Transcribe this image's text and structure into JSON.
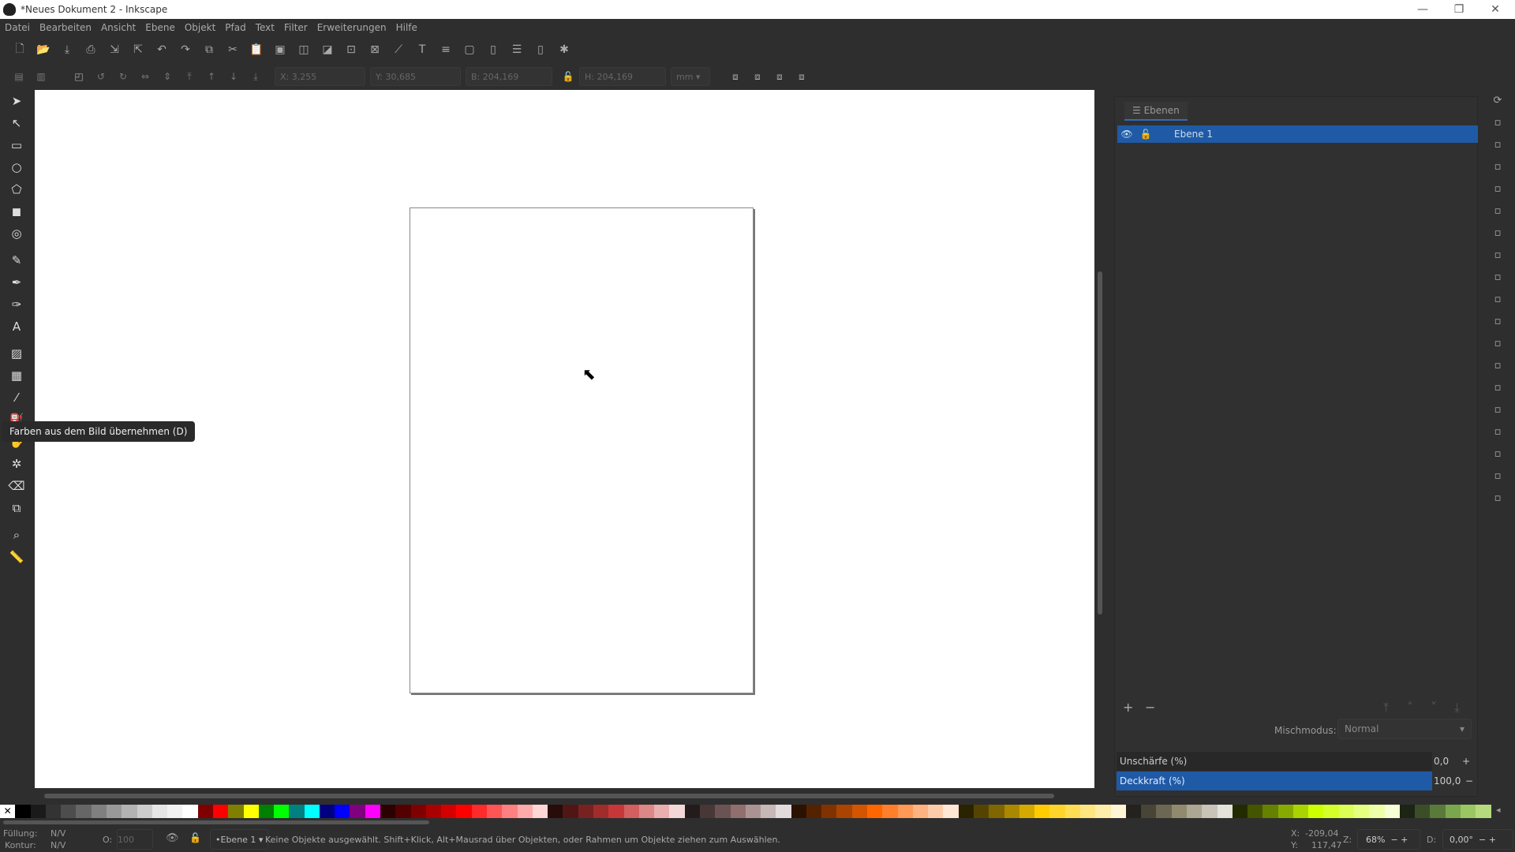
{
  "window": {
    "title": "*Neues Dokument 2 - Inkscape",
    "minimize": "—",
    "maximize": "❐",
    "close": "✕"
  },
  "menu": [
    "Datei",
    "Bearbeiten",
    "Ansicht",
    "Ebene",
    "Objekt",
    "Pfad",
    "Text",
    "Filter",
    "Erweiterungen",
    "Hilfe"
  ],
  "toolbar1_icons": [
    "new-icon",
    "open-icon",
    "save-icon",
    "print-icon",
    "import-icon",
    "export-icon",
    "undo-icon",
    "redo-icon",
    "duplicate-icon",
    "cut-icon",
    "paste-icon",
    "group-icon",
    "raise-icon",
    "lower-icon",
    "zoom-selection-icon",
    "zoom-drawing-icon",
    "xml-editor-icon",
    "text-font-icon",
    "align-icon",
    "fill-stroke-icon",
    "layers-icon",
    "object-properties-icon",
    "document-properties-icon",
    "preferences-icon"
  ],
  "toolbar2": {
    "x_label": "X:",
    "x": "3,255",
    "y_label": "Y:",
    "y": "30,685",
    "w_label": "B:",
    "w": "204,169",
    "h_label": "H:",
    "h": "204,169",
    "unit": "mm"
  },
  "tools": [
    {
      "name": "selector",
      "g": "➤"
    },
    {
      "name": "node",
      "g": "↖"
    },
    {
      "name": "rectangle",
      "g": "▭"
    },
    {
      "name": "ellipse",
      "g": "○"
    },
    {
      "name": "star",
      "g": "⬠"
    },
    {
      "name": "3d-box",
      "g": "◼"
    },
    {
      "name": "spiral",
      "g": "◎"
    },
    {
      "name": "pencil",
      "g": "✎"
    },
    {
      "name": "pen",
      "g": "✒"
    },
    {
      "name": "calligraphy",
      "g": "✑"
    },
    {
      "name": "text",
      "g": "A"
    },
    {
      "name": "gradient",
      "g": "▨"
    },
    {
      "name": "mesh",
      "g": "▦"
    },
    {
      "name": "dropper",
      "g": "⁄"
    },
    {
      "name": "paint-bucket",
      "g": "⛽"
    },
    {
      "name": "tweak",
      "g": "✋"
    },
    {
      "name": "spray",
      "g": "✲"
    },
    {
      "name": "eraser",
      "g": "⌫"
    },
    {
      "name": "connector",
      "g": "⧉"
    },
    {
      "name": "zoom",
      "g": "⌕"
    },
    {
      "name": "measure",
      "g": "📏"
    }
  ],
  "tooltip": "Farben aus dem Bild übernehmen (D)",
  "panel": {
    "tab": "Ebenen",
    "tab_close": "×",
    "layer": "Ebene 1",
    "add": "+",
    "remove": "−",
    "blend_label": "Mischmodus:",
    "blend_value": "Normal",
    "blur_label": "Unschärfe (%)",
    "blur_value": "0,0",
    "opacity_label": "Deckkraft (%)",
    "opacity_value": "100,0"
  },
  "palette": [
    "#000000",
    "#1a1a1a",
    "#333333",
    "#4d4d4d",
    "#666666",
    "#808080",
    "#999999",
    "#b3b3b3",
    "#cccccc",
    "#e6e6e6",
    "#f2f2f2",
    "#ffffff",
    "#800000",
    "#ff0000",
    "#808000",
    "#ffff00",
    "#008000",
    "#00ff00",
    "#008080",
    "#00ffff",
    "#000080",
    "#0000ff",
    "#800080",
    "#ff00ff",
    "#2b0000",
    "#550000",
    "#800000",
    "#aa0000",
    "#d40000",
    "#ff0000",
    "#ff2a2a",
    "#ff5555",
    "#ff8080",
    "#ffaaaa",
    "#ffd5d5",
    "#280b0b",
    "#501616",
    "#782121",
    "#a02c2c",
    "#c83737",
    "#d35f5f",
    "#de8787",
    "#e9afaf",
    "#f4d7d7",
    "#241c1c",
    "#483737",
    "#6c5353",
    "#916f6f",
    "#ac9393",
    "#c8b7b7",
    "#e3dbdb",
    "#2b1100",
    "#552200",
    "#803300",
    "#aa4400",
    "#d45500",
    "#ff6600",
    "#ff7f2a",
    "#ff9955",
    "#ffb380",
    "#ffccaa",
    "#ffe6d5",
    "#2b2200",
    "#554400",
    "#806600",
    "#aa8800",
    "#d4aa00",
    "#ffcc00",
    "#ffd42a",
    "#ffdd55",
    "#ffe680",
    "#ffeeaa",
    "#fff6d5",
    "#24221c",
    "#484537",
    "#6c6753",
    "#918a6f",
    "#aca793",
    "#c8c4b7",
    "#e3e2db",
    "#222b00",
    "#445500",
    "#668000",
    "#88aa00",
    "#aad400",
    "#ccff00",
    "#d4ff2a",
    "#ddff55",
    "#e5ff80",
    "#eeffaa",
    "#f6ffd5",
    "#1c2414",
    "#3b4e27",
    "#5a7a3a",
    "#7aa64e",
    "#9ac762",
    "#b5d97d"
  ],
  "status": {
    "fill_label": "Füllung:",
    "fill": "N/V",
    "stroke_label": "Kontur:",
    "stroke": "N/V",
    "opacity_label": "O:",
    "opacity": "100",
    "layer": "•Ebene 1",
    "message": "Keine Objekte ausgewählt. Shift+Klick, Alt+Mausrad über Objekten, oder Rahmen um Objekte ziehen zum Auswählen.",
    "x_label": "X:",
    "x": "-209,04",
    "y_label": "Y:",
    "y": "117,47",
    "zoom_label": "Z:",
    "zoom": "68%",
    "rot_label": "D:",
    "rotation": "0,00°"
  }
}
